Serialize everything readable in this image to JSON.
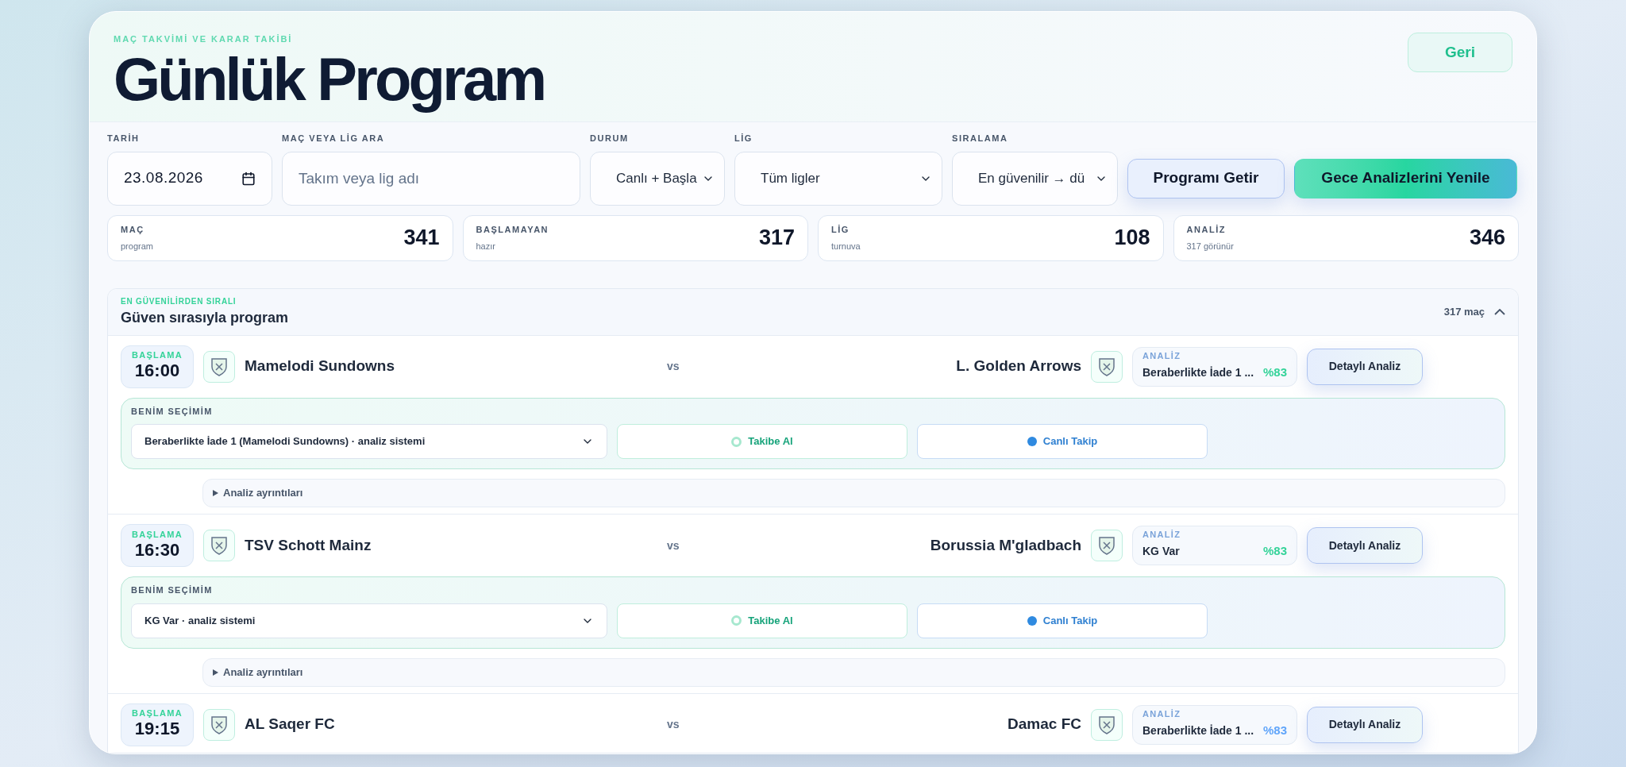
{
  "header": {
    "eyebrow": "MAÇ TAKVİMİ VE KARAR TAKİBİ",
    "title": "Günlük Program",
    "back_button": "Geri"
  },
  "filters": [
    {
      "kind": "date",
      "label": "TARİH",
      "value": "23.08.2026"
    },
    {
      "kind": "search",
      "label": "MAÇ VEYA LİG ARA",
      "placeholder": "Takım veya lig adı"
    },
    {
      "kind": "select",
      "label": "DURUM",
      "value": "Canlı + Başla"
    },
    {
      "kind": "select",
      "label": "LİG",
      "value": "Tüm ligler"
    },
    {
      "kind": "select",
      "label": "SIRALAMA",
      "value": "En güvenilir → dü"
    }
  ],
  "actions": [
    {
      "kind": "secondary",
      "label": "Programı Getir"
    },
    {
      "kind": "primary",
      "label": "Gece Analizlerini Yenile"
    }
  ],
  "stats": [
    {
      "label": "MAÇ",
      "sublabel": "program",
      "value": "341"
    },
    {
      "label": "BAŞLAMAYAN",
      "sublabel": "hazır",
      "value": "317"
    },
    {
      "label": "LİG",
      "sublabel": "turnuva",
      "value": "108"
    },
    {
      "label": "ANALİZ",
      "sublabel": "317 görünür",
      "value": "346"
    }
  ],
  "section": {
    "eyebrow": "EN GÜVENİLİRDEN SIRALI",
    "title": "Güven sırasıyla program",
    "count": "317 maç",
    "expanded": true
  },
  "matches": [
    {
      "start_label": "BAŞLAMA",
      "time": "16:00",
      "home": "Mamelodi Sundowns",
      "vs": "vs",
      "away": "L. Golden Arrows",
      "analysis_label": "ANALİZ",
      "analysis": "Beraberlikte İade 1 ...",
      "confidence": "%83",
      "color": "#34d399",
      "detail_button": "Detaylı Analiz",
      "pick": {
        "label": "BENİM SEÇİMİM",
        "value": "Beraberlikte İade 1 (Mamelodi Sundowns) · analiz sistemi",
        "track_button": "Takibe Al",
        "live_button": "Canlı Takip"
      },
      "details": "Analiz ayrıntıları"
    },
    {
      "start_label": "BAŞLAMA",
      "time": "16:30",
      "home": "TSV Schott Mainz",
      "vs": "vs",
      "away": "Borussia M'gladbach",
      "analysis_label": "ANALİZ",
      "analysis": "KG Var",
      "confidence": "%83",
      "color": "#34d399",
      "detail_button": "Detaylı Analiz",
      "pick": {
        "label": "BENİM SEÇİMİM",
        "value": "KG Var · analiz sistemi",
        "track_button": "Takibe Al",
        "live_button": "Canlı Takip"
      },
      "details": "Analiz ayrıntıları"
    },
    {
      "start_label": "BAŞLAMA",
      "time": "19:15",
      "home": "AL Saqer FC",
      "vs": "vs",
      "away": "Damac FC",
      "analysis_label": "ANALİZ",
      "analysis": "Beraberlikte İade 1 ...",
      "confidence": "%83",
      "color": "#60a5fa",
      "detail_button": "Detaylı Analiz"
    }
  ]
}
